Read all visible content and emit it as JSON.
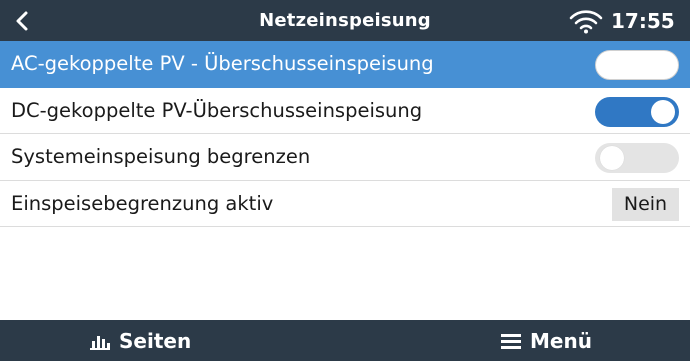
{
  "header": {
    "title": "Netzeinspeisung",
    "time": "17:55",
    "back_icon": "chevron-left-icon",
    "wifi_icon": "wifi-icon"
  },
  "rows": [
    {
      "label": "AC-gekoppelte PV - Überschusseinspeisung",
      "type": "switch",
      "state": "off",
      "selected": true
    },
    {
      "label": "DC-gekoppelte PV-Überschusseinspeisung",
      "type": "switch",
      "state": "on",
      "selected": false
    },
    {
      "label": "Systemeinspeisung begrenzen",
      "type": "switch",
      "state": "off",
      "selected": false
    },
    {
      "label": "Einspeisebegrenzung aktiv",
      "type": "value",
      "value": "Nein",
      "selected": false
    }
  ],
  "footer": {
    "pages_label": "Seiten",
    "pages_icon": "bar-chart-icon",
    "menu_label": "Menü",
    "menu_icon": "hamburger-menu-icon"
  },
  "colors": {
    "header_bg": "#2c3a48",
    "selected_row": "#4790d4",
    "switch_on": "#3078c4",
    "switch_off": "#e4e4e4"
  }
}
